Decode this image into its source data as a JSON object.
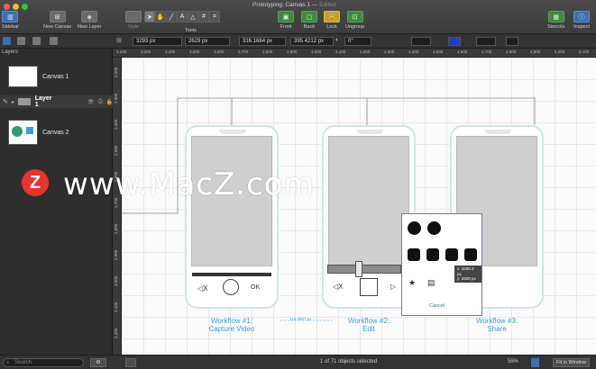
{
  "window": {
    "title": "Prototyping: Canvas 1",
    "status": "Edited",
    "traffic_colors": [
      "#ff5f57",
      "#febc2e",
      "#28c840"
    ]
  },
  "toolbar": {
    "sidebar": "Sidebar",
    "new_canvas": "New Canvas",
    "new_layer": "New Layer",
    "style": "Style",
    "tools": "Tools",
    "front": "Front",
    "back": "Back",
    "lock": "Lock",
    "ungroup": "Ungroup",
    "stencils": "Stencils",
    "inspect": "Inspect"
  },
  "inspector": {
    "x": "3293 px",
    "y": "2629 px",
    "width": "316.1684 px",
    "height": "395.4212 px",
    "rotation": "0°"
  },
  "sidebar": {
    "heading": "Layers",
    "canvases": [
      {
        "name": "Canvas 1"
      },
      {
        "name": "Layer 1"
      },
      {
        "name": "Canvas 2"
      }
    ]
  },
  "rulers": {
    "h": [
      "3,200",
      "3,300",
      "3,400",
      "3,500",
      "3,600",
      "3,700",
      "3,800",
      "3,900",
      "4,000",
      "4,100",
      "4,200",
      "4,300",
      "4,400",
      "4,500",
      "4,600",
      "4,700",
      "4,800",
      "4,900",
      "5,000",
      "5,100"
    ],
    "v": [
      "2,200",
      "2,300",
      "2,400",
      "2,500",
      "2,600",
      "2,700",
      "2,800",
      "2,900",
      "3,000",
      "3,100",
      "3,200"
    ]
  },
  "canvas": {
    "workflows": [
      {
        "title": "Workflow #1:",
        "subtitle": "Capture Video"
      },
      {
        "title": "Workflow #2:",
        "subtitle": "Edit"
      },
      {
        "title": "Workflow #3:",
        "subtitle": "Share"
      }
    ],
    "ok_label": "OK",
    "x_label": "X",
    "cancel_label": "Cancel",
    "coords_tooltip": {
      "x": "x: 3288.3 px",
      "y": "y: 2629 px"
    },
    "dimension_label": "115.3957 px"
  },
  "watermark": {
    "text": "www.MacZ.com",
    "logo": "Z"
  },
  "statusbar": {
    "search_placeholder": "Search",
    "selection": "1 of 71 objects selected",
    "zoom": "56%",
    "fit": "Fit in Window"
  }
}
